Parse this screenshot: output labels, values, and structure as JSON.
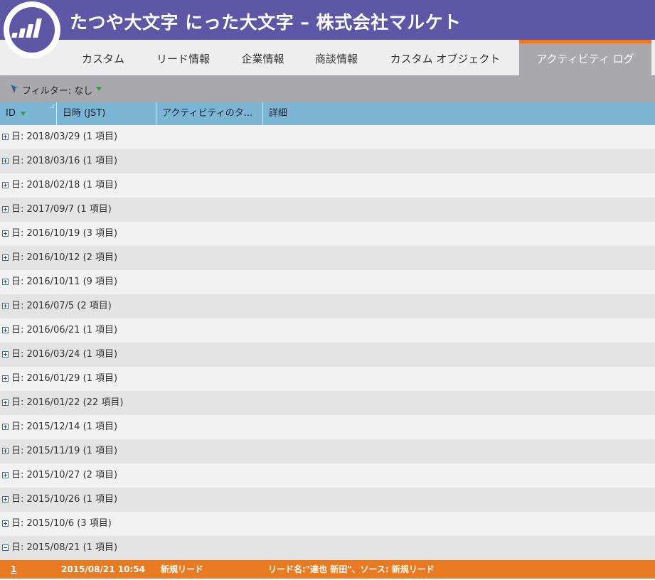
{
  "header": {
    "title": "たつや大文字 にった大文字 – 株式会社マルケト"
  },
  "tabs": [
    {
      "label": "カスタム"
    },
    {
      "label": "リード情報"
    },
    {
      "label": "企業情報"
    },
    {
      "label": "商談情報"
    },
    {
      "label": "カスタム オブジェクト"
    },
    {
      "label": "アクティビティ ログ",
      "active": true
    }
  ],
  "filter": {
    "label": "フィルター: なし"
  },
  "columns": [
    {
      "label": "ID"
    },
    {
      "label": "日時 (JST)"
    },
    {
      "label": "アクティビティのタ..."
    },
    {
      "label": "詳細"
    }
  ],
  "groups": [
    {
      "label": "日: 2018/03/29 (1 項目)"
    },
    {
      "label": "日: 2018/03/16 (1 項目)"
    },
    {
      "label": "日: 2018/02/18 (1 項目)"
    },
    {
      "label": "日: 2017/09/7 (1 項目)"
    },
    {
      "label": "日: 2016/10/19 (3 項目)"
    },
    {
      "label": "日: 2016/10/12 (2 項目)"
    },
    {
      "label": "日: 2016/10/11 (9 項目)"
    },
    {
      "label": "日: 2016/07/5 (2 項目)"
    },
    {
      "label": "日: 2016/06/21 (1 項目)"
    },
    {
      "label": "日: 2016/03/24 (1 項目)"
    },
    {
      "label": "日: 2016/01/29 (1 項目)"
    },
    {
      "label": "日: 2016/01/22 (22 項目)"
    },
    {
      "label": "日: 2015/12/14 (1 項目)"
    },
    {
      "label": "日: 2015/11/19 (1 項目)"
    },
    {
      "label": "日: 2015/10/27 (2 項目)"
    },
    {
      "label": "日: 2015/10/26 (1 項目)"
    },
    {
      "label": "日: 2015/10/6 (3 項目)"
    },
    {
      "label": "日: 2015/08/21 (1 項目)",
      "expanded": true
    }
  ],
  "detail": {
    "id": "1",
    "datetime": "2015/08/21 10:54",
    "type": "新規リード",
    "details": "リード名:\"達也 新田\"、ソース: 新規リード"
  },
  "colors": {
    "header": "#5e57a6",
    "accent": "#e87b22",
    "column_header": "#7ab6d4",
    "filter_bar": "#a9a9ad"
  }
}
